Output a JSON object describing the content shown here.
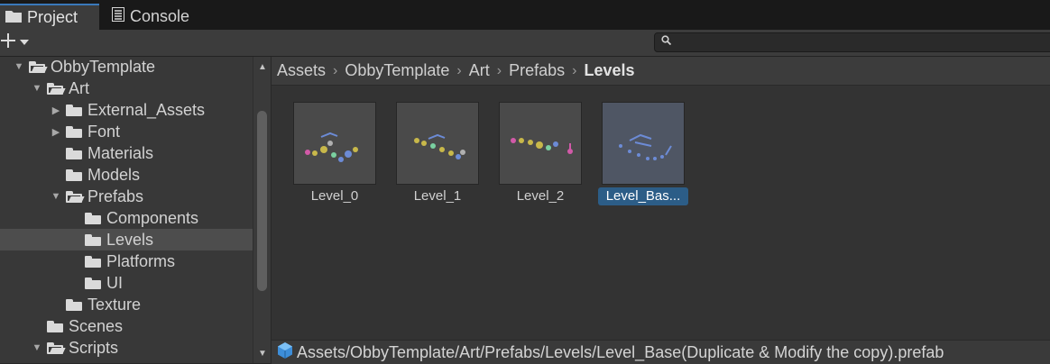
{
  "tabs": [
    {
      "label": "Project",
      "icon": "folder-icon",
      "active": true
    },
    {
      "label": "Console",
      "icon": "console-icon",
      "active": false
    }
  ],
  "toolbar": {
    "add_icon": "plus-icon",
    "add_dropdown_icon": "chevron-down-icon",
    "search_placeholder": "",
    "search_icon": "search-icon"
  },
  "tree": [
    {
      "label": "ObbyTemplate",
      "depth": 1,
      "expanded": true,
      "arrow": "▼",
      "open": true
    },
    {
      "label": "Art",
      "depth": 2,
      "expanded": true,
      "arrow": "▼",
      "open": true
    },
    {
      "label": "External_Assets",
      "depth": 3,
      "expanded": false,
      "arrow": "▶",
      "open": false
    },
    {
      "label": "Font",
      "depth": 3,
      "expanded": false,
      "arrow": "▶",
      "open": false
    },
    {
      "label": "Materials",
      "depth": 3,
      "expanded": false,
      "arrow": "",
      "open": false
    },
    {
      "label": "Models",
      "depth": 3,
      "expanded": false,
      "arrow": "",
      "open": false
    },
    {
      "label": "Prefabs",
      "depth": 3,
      "expanded": true,
      "arrow": "▼",
      "open": true
    },
    {
      "label": "Components",
      "depth": 4,
      "expanded": false,
      "arrow": "",
      "open": false
    },
    {
      "label": "Levels",
      "depth": 4,
      "expanded": false,
      "arrow": "",
      "open": false,
      "selected": true
    },
    {
      "label": "Platforms",
      "depth": 4,
      "expanded": false,
      "arrow": "",
      "open": false
    },
    {
      "label": "UI",
      "depth": 4,
      "expanded": false,
      "arrow": "",
      "open": false
    },
    {
      "label": "Texture",
      "depth": 3,
      "expanded": false,
      "arrow": "",
      "open": false
    },
    {
      "label": "Scenes",
      "depth": 2,
      "expanded": false,
      "arrow": "",
      "open": false
    },
    {
      "label": "Scripts",
      "depth": 2,
      "expanded": true,
      "arrow": "▼",
      "open": true
    }
  ],
  "breadcrumb": [
    "Assets",
    "ObbyTemplate",
    "Art",
    "Prefabs",
    "Levels"
  ],
  "assets": [
    {
      "label": "Level_0",
      "selected": false
    },
    {
      "label": "Level_1",
      "selected": false
    },
    {
      "label": "Level_2",
      "selected": false
    },
    {
      "label": "Level_Bas...",
      "selected": true
    }
  ],
  "status": {
    "icon": "prefab-cube-icon",
    "path": "Assets/ObbyTemplate/Art/Prefabs/Levels/Level_Base(Duplicate & Modify the copy).prefab"
  },
  "colors": {
    "selection": "#2c5d87",
    "tab_accent": "#3a79bb"
  }
}
